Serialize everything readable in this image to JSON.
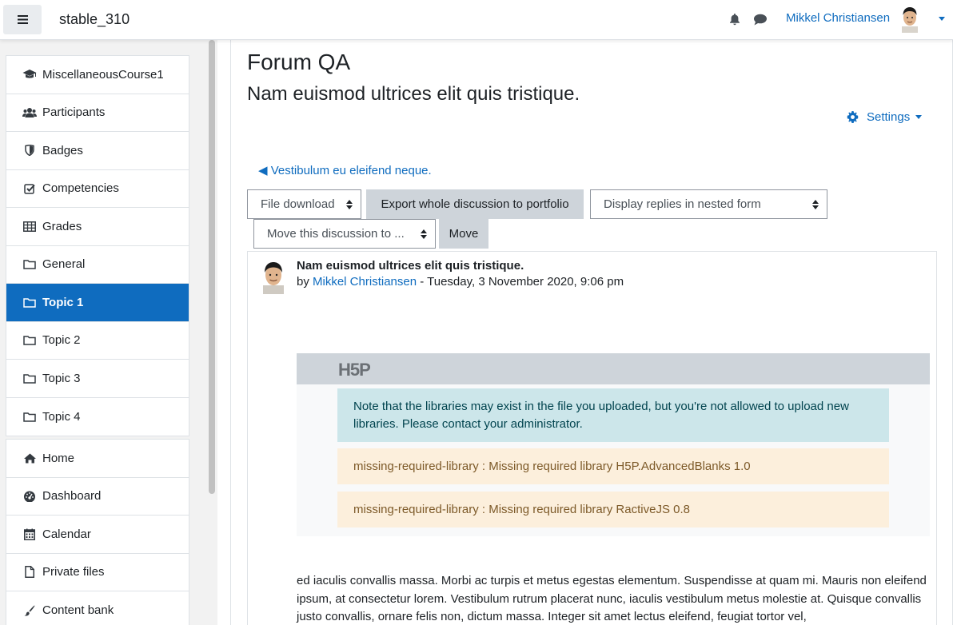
{
  "navbar": {
    "site_name": "stable_310",
    "user_name": "Mikkel Christiansen"
  },
  "drawer": {
    "course_items": [
      {
        "label": "MiscellaneousCourse1",
        "icon": "graduation-cap-icon"
      },
      {
        "label": "Participants",
        "icon": "users-icon"
      },
      {
        "label": "Badges",
        "icon": "shield-icon"
      },
      {
        "label": "Competencies",
        "icon": "check-square-icon"
      },
      {
        "label": "Grades",
        "icon": "table-icon"
      },
      {
        "label": "General",
        "icon": "folder-icon"
      },
      {
        "label": "Topic 1",
        "icon": "folder-icon",
        "active": true
      },
      {
        "label": "Topic 2",
        "icon": "folder-icon"
      },
      {
        "label": "Topic 3",
        "icon": "folder-icon"
      },
      {
        "label": "Topic 4",
        "icon": "folder-icon"
      }
    ],
    "site_items": [
      {
        "label": "Home",
        "icon": "home-icon"
      },
      {
        "label": "Dashboard",
        "icon": "dashboard-icon"
      },
      {
        "label": "Calendar",
        "icon": "calendar-icon"
      },
      {
        "label": "Private files",
        "icon": "file-icon"
      },
      {
        "label": "Content bank",
        "icon": "paint-brush-icon"
      }
    ]
  },
  "main": {
    "title": "Forum QA",
    "subtitle": "Nam euismod ultrices elit quis tristique.",
    "settings_label": "Settings",
    "prev_link": "◀ Vestibulum eu eleifend neque.",
    "file_download": "File download",
    "export_button": "Export whole discussion to portfolio",
    "display_mode": "Display replies in nested form",
    "move_select": "Move this discussion to ...",
    "move_button": "Move"
  },
  "post": {
    "subject": "Nam euismod ultrices elit quis tristique.",
    "by_prefix": "by",
    "author": "Mikkel Christiansen",
    "date": " - Tuesday, 3 November 2020, 9:06 pm",
    "h5p_logo": "H5P",
    "alert_info": "Note that the libraries may exist in the file you uploaded, but you're not allowed to upload new libraries. Please contact your administrator.",
    "alert_warn_1": "missing-required-library : Missing required library H5P.AdvancedBlanks 1.0",
    "alert_warn_2": "missing-required-library : Missing required library RactiveJS 0.8",
    "body": "ed iaculis convallis massa. Morbi ac turpis et metus egestas elementum. Suspendisse at quam mi. Mauris non eleifend ipsum, at consectetur lorem. Vestibulum rutrum placerat nunc, iaculis vestibulum metus molestie at. Quisque convallis justo convallis, ornare felis non, dictum massa. Integer sit amet lectus eleifend, feugiat tortor vel,"
  }
}
